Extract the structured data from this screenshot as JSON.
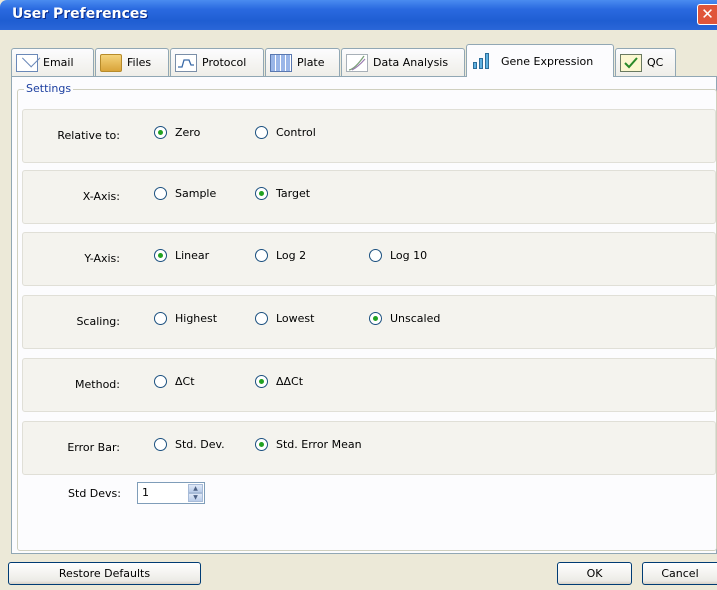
{
  "window": {
    "title": "User Preferences",
    "close_glyph": "✕"
  },
  "tabs": [
    {
      "label": "Email",
      "icon": "envelope-icon"
    },
    {
      "label": "Files",
      "icon": "folder-icon"
    },
    {
      "label": "Protocol",
      "icon": "protocol-icon"
    },
    {
      "label": "Plate",
      "icon": "plate-icon"
    },
    {
      "label": "Data Analysis",
      "icon": "data-analysis-icon"
    },
    {
      "label": "Gene Expression",
      "icon": "bar-chart-icon",
      "active": true
    },
    {
      "label": "QC",
      "icon": "qc-icon"
    }
  ],
  "settings": {
    "legend": "Settings",
    "relative_to": {
      "label": "Relative to:",
      "options": [
        "Zero",
        "Control"
      ],
      "selected": "Zero"
    },
    "x_axis": {
      "label": "X-Axis:",
      "options": [
        "Sample",
        "Target"
      ],
      "selected": "Target"
    },
    "y_axis": {
      "label": "Y-Axis:",
      "options": [
        "Linear",
        "Log 2",
        "Log 10"
      ],
      "selected": "Linear"
    },
    "scaling": {
      "label": "Scaling:",
      "options": [
        "Highest",
        "Lowest",
        "Unscaled"
      ],
      "selected": "Unscaled"
    },
    "method": {
      "label": "Method:",
      "options": [
        "ΔCt",
        "ΔΔCt"
      ],
      "selected": "ΔΔCt"
    },
    "error_bar": {
      "label": "Error Bar:",
      "options": [
        "Std. Dev.",
        "Std. Error Mean"
      ],
      "selected": "Std. Error Mean"
    },
    "std_devs": {
      "label": "Std Devs:",
      "value": "1"
    }
  },
  "buttons": {
    "restore": "Restore Defaults",
    "ok": "OK",
    "cancel": "Cancel"
  },
  "colors": {
    "title_bar": "#1f5ed2",
    "radio_dot": "#21a121",
    "legend_text": "#1c3fa0"
  }
}
